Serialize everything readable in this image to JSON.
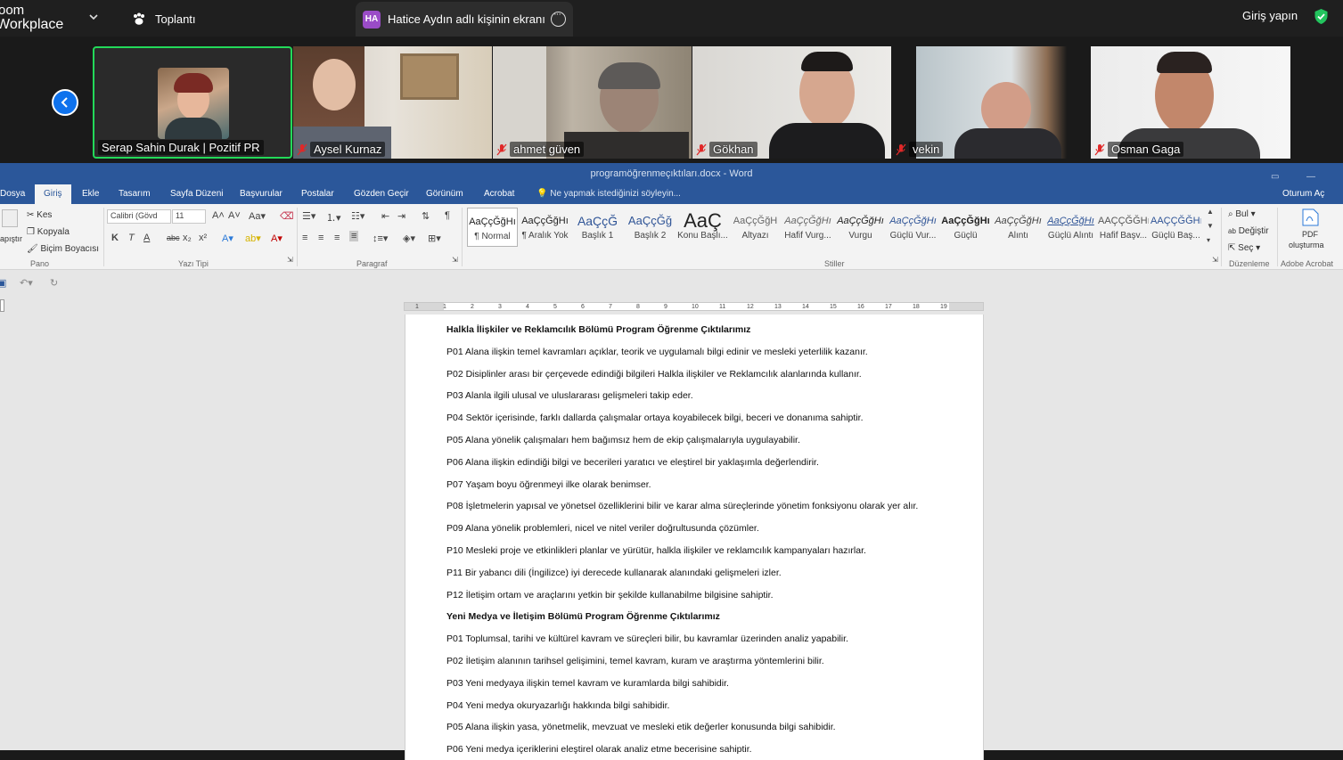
{
  "zoom": {
    "logo_line1": "oom",
    "logo_line2": "Workplace",
    "meeting_label": "Toplantı",
    "share_avatar": "HA",
    "share_label": "Hatice Aydın adlı kişinin ekranı",
    "signin_label": "Giriş yapın",
    "colors": {
      "accent": "#0e72ed",
      "active_border": "#23d959",
      "shield": "#23c45e",
      "share_avatar": "#9a4cc7"
    }
  },
  "participants": [
    {
      "name": "Serap Sahin Durak | Pozitif PR",
      "muted": false,
      "active": true
    },
    {
      "name": "Aysel Kurnaz",
      "muted": true
    },
    {
      "name": "ahmet güven",
      "muted": true
    },
    {
      "name": "Gökhan",
      "muted": true
    },
    {
      "name": "vekin",
      "muted": true
    },
    {
      "name": "Osman Gaga",
      "muted": true
    }
  ],
  "word": {
    "title": "programöğrenmeçıktıları.docx - Word",
    "tabs": [
      "Dosya",
      "Giriş",
      "Ekle",
      "Tasarım",
      "Sayfa Düzeni",
      "Başvurular",
      "Postalar",
      "Gözden Geçir",
      "Görünüm",
      "Acrobat"
    ],
    "tell_me": "Ne yapmak istediğinizi söyleyin...",
    "signin": "Oturum Aç",
    "clipboard": {
      "paste": "apıştır",
      "cut": "Kes",
      "copy": "Kopyala",
      "format_painter": "Biçim Boyacısı",
      "group": "Pano"
    },
    "font": {
      "name": "Calibri (Gövd",
      "size": "11",
      "group": "Yazı Tipi",
      "bold": "K",
      "italic": "T",
      "underline": "A",
      "strike": "abc"
    },
    "paragraph_group": "Paragraf",
    "styles": [
      {
        "sample": "AaÇçĞğHı",
        "name": "¶ Normal"
      },
      {
        "sample": "AaÇçĞğHı",
        "name": "¶ Aralık Yok"
      },
      {
        "sample": "AaÇçĞ",
        "name": "Başlık 1"
      },
      {
        "sample": "AaÇçĞğ",
        "name": "Başlık 2"
      },
      {
        "sample": "AaÇ",
        "name": "Konu Başlı..."
      },
      {
        "sample": "AaÇçĞğH",
        "name": "Altyazı"
      },
      {
        "sample": "AaÇçĞğHı",
        "name": "Hafif Vurg..."
      },
      {
        "sample": "AaÇçĞğHı",
        "name": "Vurgu"
      },
      {
        "sample": "AaÇçĞğHı",
        "name": "Güçlü Vur..."
      },
      {
        "sample": "AaÇçĞğHı",
        "name": "Güçlü"
      },
      {
        "sample": "AaÇçĞğHı",
        "name": "Alıntı"
      },
      {
        "sample": "AaÇçĞğHı",
        "name": "Güçlü Alıntı"
      },
      {
        "sample": "AAÇÇĞĞHı",
        "name": "Hafif Başv..."
      },
      {
        "sample": "AAÇÇĞĞHı",
        "name": "Güçlü Baş..."
      }
    ],
    "styles_group": "Stiller",
    "editing": {
      "find": "Bul",
      "replace": "Değiştir",
      "select": "Seç",
      "group": "Düzenleme"
    },
    "acrobat": {
      "pdf": "PDF",
      "create": "oluşturma",
      "group": "Adobe Acrobat"
    },
    "ruler_ticks": [
      "1",
      "1",
      "2",
      "3",
      "4",
      "5",
      "6",
      "7",
      "8",
      "9",
      "10",
      "11",
      "12",
      "13",
      "14",
      "15",
      "16",
      "17",
      "18",
      "19"
    ]
  },
  "document": [
    {
      "text": "Halkla İlişkiler ve Reklamcılık Bölümü Program Öğrenme Çıktılarımız",
      "heading": true
    },
    {
      "text": "P01 Alana ilişkin temel kavramları açıklar, teorik ve uygulamalı bilgi edinir ve mesleki yeterlilik kazanır."
    },
    {
      "text": "P02 Disiplinler arası bir çerçevede edindiği bilgileri Halkla ilişkiler ve Reklamcılık alanlarında kullanır."
    },
    {
      "text": "P03 Alanla ilgili ulusal ve uluslararası gelişmeleri takip eder."
    },
    {
      "text": "P04 Sektör içerisinde, farklı dallarda çalışmalar ortaya koyabilecek bilgi, beceri ve donanıma sahiptir."
    },
    {
      "text": "P05 Alana yönelik çalışmaları hem bağımsız hem de ekip çalışmalarıyla uygulayabilir."
    },
    {
      "text": "P06 Alana ilişkin edindiği bilgi ve becerileri yaratıcı ve eleştirel bir yaklaşımla değerlendirir."
    },
    {
      "text": "P07 Yaşam boyu öğrenmeyi ilke olarak benimser."
    },
    {
      "text": "P08 İşletmelerin yapısal ve yönetsel özelliklerini bilir ve karar alma süreçlerinde yönetim fonksiyonu olarak yer alır."
    },
    {
      "text": "P09 Alana yönelik problemleri, nicel ve nitel veriler doğrultusunda çözümler."
    },
    {
      "text": "P10 Mesleki proje ve etkinlikleri planlar ve yürütür, halkla ilişkiler ve reklamcılık kampanyaları hazırlar."
    },
    {
      "text": "P11 Bir yabancı dili (İngilizce) iyi derecede kullanarak alanındaki gelişmeleri izler."
    },
    {
      "text": "P12 İletişim ortam ve araçlarını yetkin bir şekilde kullanabilme bilgisine sahiptir."
    },
    {
      "text": "Yeni Medya ve İletişim Bölümü Program Öğrenme Çıktılarımız",
      "heading": true
    },
    {
      "text": "P01 Toplumsal, tarihi ve kültürel kavram ve süreçleri bilir, bu kavramlar üzerinden analiz yapabilir."
    },
    {
      "text": "P02 İletişim alanının tarihsel gelişimini, temel kavram, kuram ve araştırma yöntemlerini bilir."
    },
    {
      "text": "P03 Yeni medyaya ilişkin temel kavram ve kuramlarda bilgi sahibidir."
    },
    {
      "text": "P04 Yeni medya okuryazarlığı hakkında bilgi sahibidir."
    },
    {
      "text": "P05 Alana ilişkin yasa, yönetmelik, mevzuat ve mesleki etik değerler konusunda bilgi sahibidir."
    },
    {
      "text": "P06 Yeni medya içeriklerini eleştirel olarak analiz etme becerisine sahiptir."
    }
  ]
}
